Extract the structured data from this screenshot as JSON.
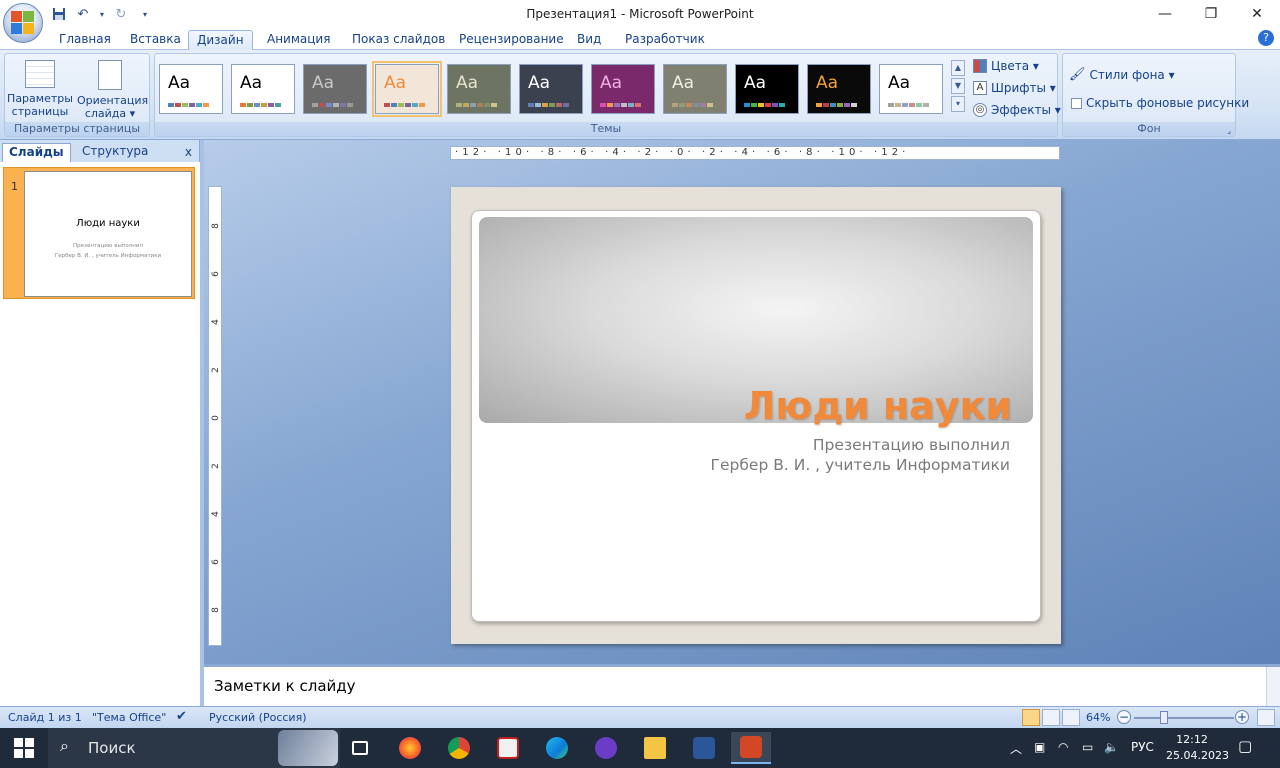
{
  "window": {
    "title": "Презентация1 - Microsoft PowerPoint",
    "minimize": "—",
    "restore": "❐",
    "close": "✕"
  },
  "qat": {
    "save_icon": "save-icon",
    "undo_icon": "undo-icon",
    "redo_icon": "redo-icon"
  },
  "tabs": [
    "Главная",
    "Вставка",
    "Дизайн",
    "Анимация",
    "Показ слайдов",
    "Рецензирование",
    "Вид",
    "Разработчик"
  ],
  "active_tab": "Дизайн",
  "ribbon": {
    "page_setup": {
      "label": "Параметры страницы",
      "params_line1": "Параметры",
      "params_line2": "страницы",
      "orient_line1": "Ориентация",
      "orient_line2": "слайда ▾"
    },
    "themes": {
      "label": "Темы",
      "aa": "Aa",
      "items": [
        {
          "bg": "#ffffff",
          "fg": "#000000",
          "dots": [
            "#4f81bd",
            "#c0504d",
            "#9bbb59",
            "#8064a2",
            "#4bacc6",
            "#f79646"
          ]
        },
        {
          "bg": "#ffffff",
          "fg": "#000000",
          "dots": [
            "#e07b39",
            "#7f9f3f",
            "#6b8fc2",
            "#c2a13a",
            "#8c5ea8",
            "#4aa0a0"
          ]
        },
        {
          "bg": "#6b6b6b",
          "fg": "#c8c8c8",
          "dots": [
            "#a1a1a1",
            "#c0504d",
            "#6f8fc0",
            "#b6b6b6",
            "#7a7aa0",
            "#999999"
          ]
        },
        {
          "bg": "#f2e6d9",
          "fg": "#f08a3a",
          "dots": [
            "#c0504d",
            "#4f81bd",
            "#9bbb59",
            "#8064a2",
            "#4bacc6",
            "#f79646"
          ]
        },
        {
          "bg": "#6e7462",
          "fg": "#e7e3d3",
          "dots": [
            "#a8b47a",
            "#c9a55c",
            "#8a9fb2",
            "#b07a5c",
            "#7f8f6f",
            "#d6c08a"
          ]
        },
        {
          "bg": "#3c4150",
          "fg": "#ffffff",
          "dots": [
            "#5f7fb0",
            "#9fbad8",
            "#d9a441",
            "#7c9b5b",
            "#b26a6a",
            "#6f6f9f"
          ]
        },
        {
          "bg": "#7a2a6a",
          "fg": "#f0b0e0",
          "dots": [
            "#d94fb2",
            "#f09a4a",
            "#9f6fc0",
            "#c0c0c0",
            "#7fb0d0",
            "#e07070"
          ]
        },
        {
          "bg": "#7f806f",
          "fg": "#efeedf",
          "dots": [
            "#b5a17a",
            "#8f9f6f",
            "#c28a5f",
            "#7f8fa0",
            "#a07f9f",
            "#d0c090"
          ]
        },
        {
          "bg": "#000000",
          "fg": "#ffffff",
          "dots": [
            "#1f8fd8",
            "#46b446",
            "#f0c020",
            "#d84040",
            "#8050c0",
            "#20b0b0"
          ]
        },
        {
          "bg": "#0a0a0a",
          "fg": "#f2a33a",
          "dots": [
            "#f2a33a",
            "#c04040",
            "#3c8fc0",
            "#8cb040",
            "#a060c0",
            "#d0d0d0"
          ]
        },
        {
          "bg": "#ffffff",
          "fg": "#000000",
          "dots": [
            "#a0a0a0",
            "#c8b48c",
            "#8ca0c8",
            "#c88c8c",
            "#8cc8a0",
            "#b0b0b0"
          ]
        }
      ]
    },
    "theme_cmds": {
      "colors": "Цвета ▾",
      "fonts": "Шрифты ▾",
      "effects": "Эффекты ▾"
    },
    "background": {
      "label": "Фон",
      "styles": "Стили фона ▾",
      "hide": "Скрыть фоновые рисунки"
    }
  },
  "left_pane": {
    "tab_slides": "Слайды",
    "tab_outline": "Структура",
    "close": "x",
    "slide_num": "1"
  },
  "rulers": {
    "h": "·12· ·10· ·8· ·6· ·4· ·2· ·0· ·2· ·4· ·6· ·8· ·10· ·12·",
    "v": [
      "8",
      "6",
      "4",
      "2",
      "0",
      "2",
      "4",
      "6",
      "8"
    ]
  },
  "slide": {
    "title": "Люди науки",
    "subtitle_1": "Презентацию выполнил",
    "subtitle_2": "Гербер В. И. , учитель Информатики"
  },
  "notes": {
    "placeholder": "Заметки к слайду"
  },
  "status": {
    "slide": "Слайд 1 из 1",
    "theme": "\"Тема Office\"",
    "lang": "Русский (Россия)",
    "zoom": "64%"
  },
  "taskbar": {
    "search": "Поиск",
    "lang": "РУС",
    "time": "12:12",
    "date": "25.04.2023"
  }
}
